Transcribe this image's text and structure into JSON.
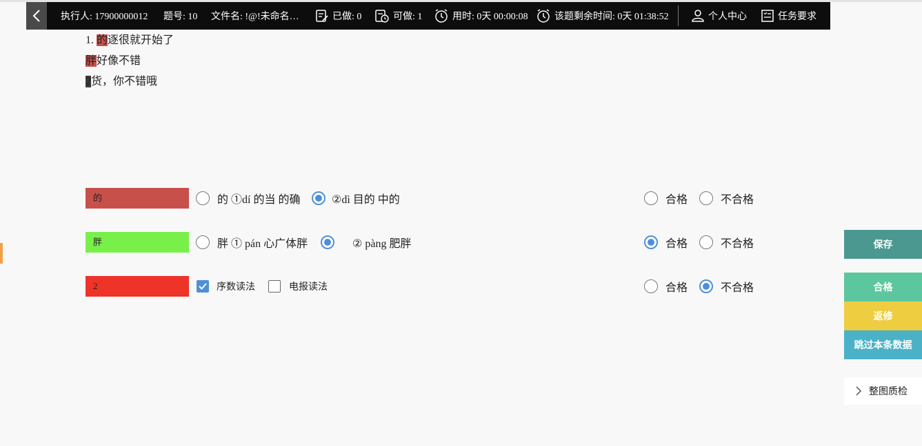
{
  "header": {
    "executor": "执行人: 17900000012",
    "question_no": "题号: 10",
    "filename": "文件名: !@!未命名…",
    "done": "已做: 0",
    "available": "可做: 1",
    "time_used": "用时: 0天 00:00:08",
    "time_left": "该题剩余时间: 0天 01:38:52",
    "profile": "个人中心",
    "requirements": "任务要求"
  },
  "text_block": {
    "line1_prefix": "1. ",
    "line1_mark": "的",
    "line1_rest": "逐很就开始了",
    "line2_mark": "胖",
    "line2_rest": "好像不错",
    "line3_mark": "2",
    "line3_rest": "货，你不错哦"
  },
  "rows": [
    {
      "tag": "的",
      "tag_color": "#c8504a",
      "option1": "的 ①dí 的当 的确",
      "option1_selected": false,
      "option2": "②dì 目的 中的",
      "option2_selected": true,
      "pass": "合格",
      "pass_selected": false,
      "fail": "不合格",
      "fail_selected": false
    },
    {
      "tag": "胖",
      "tag_color": "#79f04a",
      "option1": "胖 ① pán 心广体胖",
      "option1_selected": false,
      "option2": "② pàng 肥胖",
      "option2_selected": true,
      "pass": "合格",
      "pass_selected": true,
      "fail": "不合格",
      "fail_selected": false
    },
    {
      "tag": "2",
      "tag_color": "#ee3328",
      "option1": "序数读法",
      "option1_selected": true,
      "option2": "电报读法",
      "option2_selected": false,
      "pass": "合格",
      "pass_selected": false,
      "fail": "不合格",
      "fail_selected": true
    }
  ],
  "sidebar": {
    "save": "保存",
    "pass": "合格",
    "return": "返修",
    "skip": "跳过本条数据",
    "whole_check": "整图质检"
  },
  "colors": {
    "save": "#4a9890",
    "pass": "#5cc79e",
    "return": "#efcd40",
    "skip": "#4bb1c7",
    "radio_on": "#4e8fd9"
  }
}
